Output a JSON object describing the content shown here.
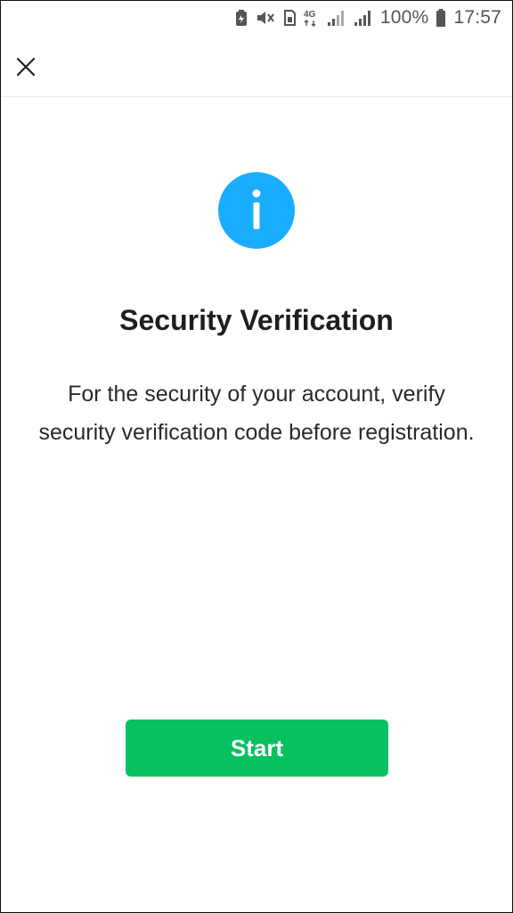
{
  "status_bar": {
    "network_type": "4G",
    "battery_percent": "100%",
    "time": "17:57",
    "icons": [
      "battery-saver-icon",
      "mute-icon",
      "sim-icon",
      "network-4g-icon",
      "signal-icon",
      "signal-icon",
      "battery-icon"
    ]
  },
  "header": {
    "close_icon": "close-icon"
  },
  "main": {
    "info_icon": "info-icon",
    "title": "Security Verification",
    "description": "For the security of your account, verify security verification code before registration.",
    "start_button_label": "Start"
  },
  "colors": {
    "accent_green": "#07c160",
    "info_blue": "#1aadff",
    "status_gray": "#555555",
    "text_dark": "#1e1e1e"
  }
}
